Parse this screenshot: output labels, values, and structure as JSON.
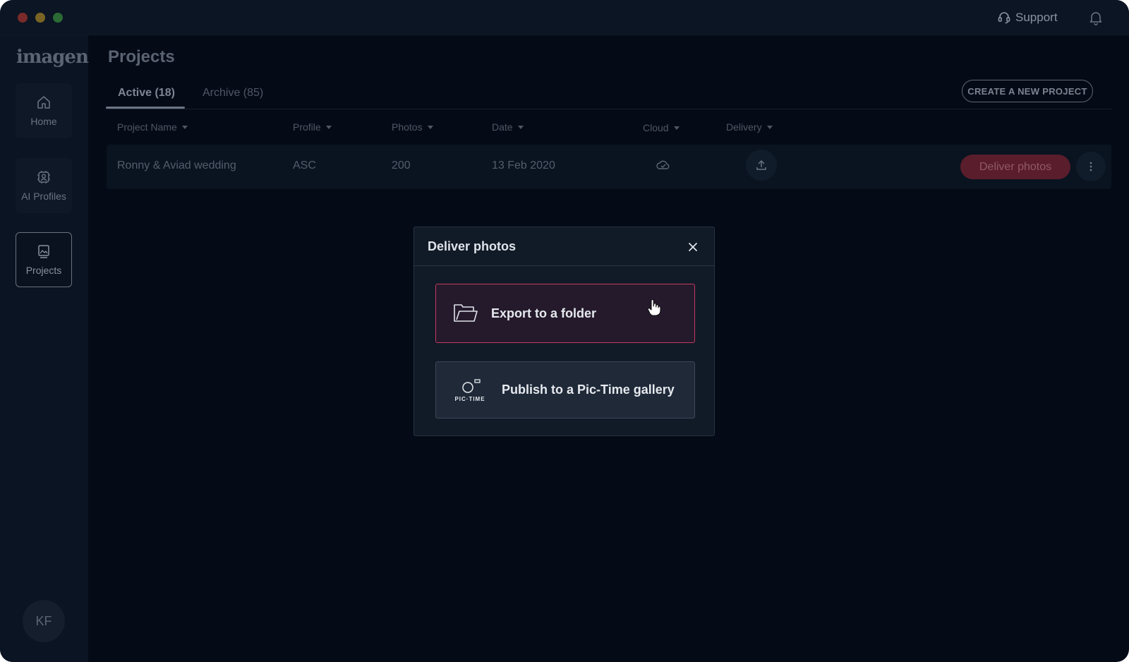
{
  "titlebar": {
    "support_label": "Support",
    "icons": [
      "headset-icon",
      "bell-icon"
    ]
  },
  "sidebar": {
    "logo": "imagen",
    "items": [
      {
        "label": "Home",
        "icon": "home-icon",
        "active": false
      },
      {
        "label": "AI Profiles",
        "icon": "ai-profile-icon",
        "active": false
      },
      {
        "label": "Projects",
        "icon": "projects-icon",
        "active": true
      }
    ],
    "avatar_initials": "KF"
  },
  "main": {
    "title": "Projects",
    "tabs": [
      {
        "label": "Active (18)",
        "active": true
      },
      {
        "label": "Archive (85)",
        "active": false
      }
    ],
    "create_button_label": "CREATE A NEW PROJECT",
    "table": {
      "columns": [
        "Project Name",
        "Profile",
        "Photos",
        "Date",
        "Cloud",
        "Delivery"
      ],
      "rows": [
        {
          "project_name": "Ronny & Aviad wedding",
          "profile": "ASC",
          "photos": "200",
          "date": "13 Feb 2020",
          "cloud_icon": "cloud-check-icon",
          "delivery_icon": "upload-icon",
          "action_label": "Deliver photos"
        }
      ]
    }
  },
  "modal": {
    "title": "Deliver photos",
    "options": [
      {
        "label": "Export to a folder",
        "icon": "folder-icon",
        "highlighted": true
      },
      {
        "label": "Publish to a Pic-Time gallery",
        "icon": "pic-time-logo",
        "logo_text": "PIC·TIME",
        "highlighted": false
      }
    ]
  },
  "colors": {
    "background": "#050b16",
    "accent": "#c23a5e",
    "modal_bg": "#111a27"
  }
}
